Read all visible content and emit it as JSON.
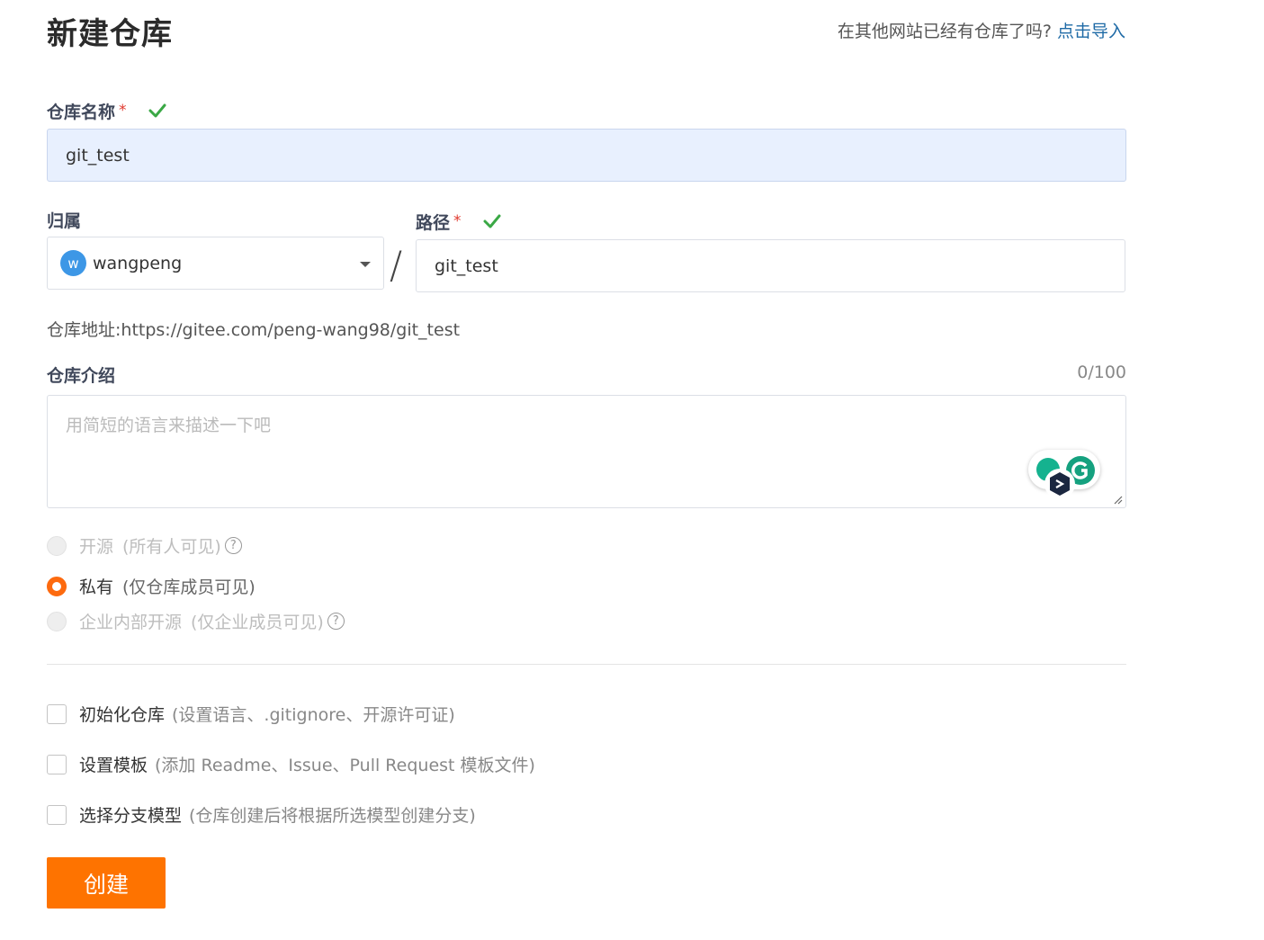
{
  "page": {
    "title": "新建仓库",
    "import_prompt": "在其他网站已经有仓库了吗?",
    "import_link": "点击导入"
  },
  "form": {
    "name_label": "仓库名称",
    "required_mark": "*",
    "name_value": "git_test",
    "owner_label": "归属",
    "owner_avatar_letter": "w",
    "owner_value": "wangpeng",
    "slash": "/",
    "path_label": "路径",
    "path_value": "git_test",
    "address": "仓库地址:https://gitee.com/peng-wang98/git_test",
    "intro_label": "仓库介绍",
    "intro_count": "0/100",
    "intro_placeholder": "用简短的语言来描述一下吧"
  },
  "visibility": {
    "options": [
      {
        "label": "开源",
        "hint": "(所有人可见)",
        "selected": false,
        "disabled": true
      },
      {
        "label": "私有",
        "hint": "(仅仓库成员可见)",
        "selected": true,
        "disabled": false
      },
      {
        "label": "企业内部开源",
        "hint": "(仅企业成员可见)",
        "selected": false,
        "disabled": true
      }
    ],
    "help_glyph": "?"
  },
  "options": {
    "init": {
      "label": "初始化仓库",
      "hint": "(设置语言、.gitignore、开源许可证)"
    },
    "template": {
      "label": "设置模板",
      "hint": "(添加 Readme、Issue、Pull Request 模板文件)"
    },
    "branch": {
      "label": "选择分支模型",
      "hint": "(仓库创建后将根据所选模型创建分支)"
    }
  },
  "actions": {
    "create_label": "创建"
  },
  "colors": {
    "accent": "#fe7300",
    "link": "#1e6aa6",
    "check": "#3aa845"
  }
}
